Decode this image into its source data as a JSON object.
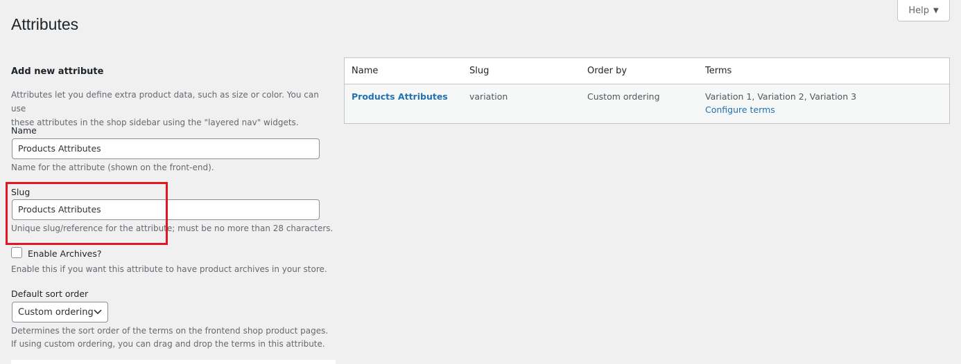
{
  "page": {
    "title": "Attributes",
    "help_label": "Help"
  },
  "form": {
    "section_title": "Add new attribute",
    "intro_line1": "Attributes let you define extra product data, such as size or color. You can use",
    "intro_line2": "these attributes in the shop sidebar using the \"layered nav\" widgets.",
    "name": {
      "label": "Name",
      "value": "Products Attributes",
      "description": "Name for the attribute (shown on the front-end)."
    },
    "slug": {
      "label": "Slug",
      "value": "Products Attributes",
      "description": "Unique slug/reference for the attribute; must be no more than 28 characters."
    },
    "archives": {
      "label": "Enable Archives?",
      "checked": false,
      "description": "Enable this if you want this attribute to have product archives in your store."
    },
    "sort_order": {
      "label": "Default sort order",
      "selected": "Custom ordering",
      "description_line1": "Determines the sort order of the terms on the frontend shop product pages.",
      "description_line2": "If using custom ordering, you can drag and drop the terms in this attribute."
    }
  },
  "table": {
    "headers": [
      "Name",
      "Slug",
      "Order by",
      "Terms"
    ],
    "rows": [
      {
        "name": "Products Attributes",
        "slug": "variation",
        "order_by": "Custom ordering",
        "terms": "Variation 1, Variation 2, Variation 3",
        "configure_label": "Configure terms"
      }
    ]
  },
  "colors": {
    "background": "#f0f0f1",
    "link": "#2271b1",
    "highlight": "#e1161e"
  }
}
